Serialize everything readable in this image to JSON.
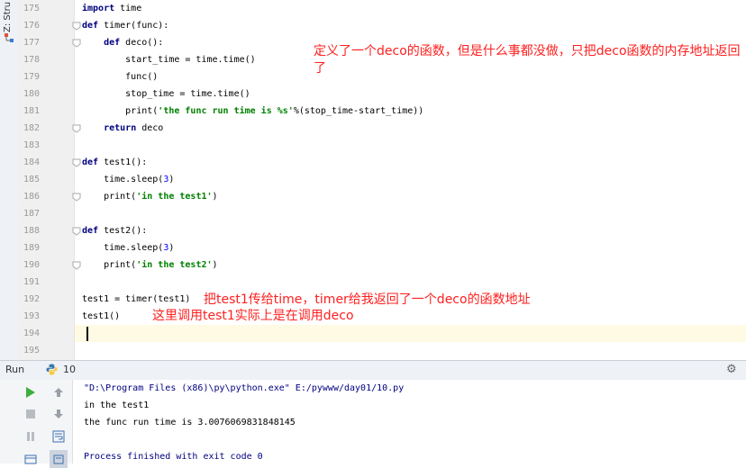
{
  "side_strip": {
    "label": "Z: Stru"
  },
  "editor": {
    "line_numbers": [
      "175",
      "176",
      "177",
      "178",
      "179",
      "180",
      "181",
      "182",
      "183",
      "184",
      "185",
      "186",
      "187",
      "188",
      "189",
      "190",
      "191",
      "192",
      "193",
      "194",
      "195"
    ],
    "lines": [
      [
        {
          "t": "import",
          "k": "kw"
        },
        {
          "t": " time"
        }
      ],
      [
        {
          "t": "def",
          "k": "kw"
        },
        {
          "t": " timer(func):"
        }
      ],
      [
        {
          "t": "    "
        },
        {
          "t": "def",
          "k": "kw"
        },
        {
          "t": " deco():"
        }
      ],
      [
        {
          "t": "        start_time = time.time()"
        }
      ],
      [
        {
          "t": "        func()"
        }
      ],
      [
        {
          "t": "        stop_time = time.time()"
        }
      ],
      [
        {
          "t": "        print("
        },
        {
          "t": "'the func run time is %s'",
          "k": "str"
        },
        {
          "t": "%(stop_time-start_time))"
        }
      ],
      [
        {
          "t": "    "
        },
        {
          "t": "return",
          "k": "kw"
        },
        {
          "t": " deco"
        }
      ],
      [],
      [
        {
          "t": "def",
          "k": "kw"
        },
        {
          "t": " test1():"
        }
      ],
      [
        {
          "t": "    time.sleep("
        },
        {
          "t": "3",
          "k": "num"
        },
        {
          "t": ")"
        }
      ],
      [
        {
          "t": "    print("
        },
        {
          "t": "'in the test1'",
          "k": "str"
        },
        {
          "t": ")"
        }
      ],
      [],
      [
        {
          "t": "def",
          "k": "kw"
        },
        {
          "t": " test2():"
        }
      ],
      [
        {
          "t": "    time.sleep("
        },
        {
          "t": "3",
          "k": "num"
        },
        {
          "t": ")"
        }
      ],
      [
        {
          "t": "    print("
        },
        {
          "t": "'in the test2'",
          "k": "str"
        },
        {
          "t": ")"
        }
      ],
      [],
      [
        {
          "t": "test1 = timer(test1)"
        }
      ],
      [
        {
          "t": "test1()"
        }
      ],
      [],
      []
    ],
    "annotations": {
      "deco_note": "定义了一个deco的函数，但是什么事都没做，只把deco函数的内存地址返回了",
      "timer_note": "把test1传给time，timer给我返回了一个deco的函数地址",
      "call_note": "这里调用test1实际上是在调用deco"
    }
  },
  "run_panel": {
    "label": "Run",
    "config_name": "10",
    "output": [
      "\"D:\\Program Files (x86)\\py\\python.exe\" E:/pywww/day01/10.py",
      "in the test1",
      "the func run time is 3.0076069831848145",
      "",
      "Process finished with exit code 0"
    ]
  }
}
